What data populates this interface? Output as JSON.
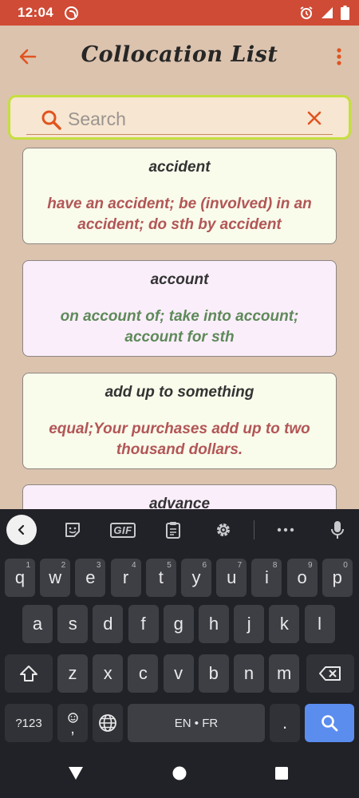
{
  "status_bar": {
    "time": "12:04"
  },
  "app_bar": {
    "title": "Collocation List"
  },
  "search": {
    "placeholder": "Search",
    "value": ""
  },
  "cards": [
    {
      "word": "accident",
      "meaning": "have an accident; be (involved) in an accident; do sth by accident",
      "bg": "#f9fbeb",
      "meaning_color": "#b25656"
    },
    {
      "word": "account",
      "meaning": "on account of; take into account; account for sth",
      "bg": "#fbeefb",
      "meaning_color": "#5e8a59"
    },
    {
      "word": "add up to something",
      "meaning": "equal;Your purchases add up to two thousand dollars.",
      "bg": "#f9fbeb",
      "meaning_color": "#b25656"
    },
    {
      "word": "advance",
      "meaning": "",
      "bg": "#fbeefb",
      "meaning_color": "#5e8a59"
    }
  ],
  "keyboard": {
    "row1": [
      {
        "k": "q",
        "h": "1"
      },
      {
        "k": "w",
        "h": "2"
      },
      {
        "k": "e",
        "h": "3"
      },
      {
        "k": "r",
        "h": "4"
      },
      {
        "k": "t",
        "h": "5"
      },
      {
        "k": "y",
        "h": "6"
      },
      {
        "k": "u",
        "h": "7"
      },
      {
        "k": "i",
        "h": "8"
      },
      {
        "k": "o",
        "h": "9"
      },
      {
        "k": "p",
        "h": "0"
      }
    ],
    "row2": [
      "a",
      "s",
      "d",
      "f",
      "g",
      "h",
      "j",
      "k",
      "l"
    ],
    "row3": [
      "z",
      "x",
      "c",
      "v",
      "b",
      "n",
      "m"
    ],
    "symbols_label": "?123",
    "comma_label": ",",
    "space_label": "EN • FR",
    "period_label": ".",
    "gif_label": "GIF"
  },
  "colors": {
    "accent": "#e0541f",
    "status_bar": "#cf4b36",
    "background": "#dcc3ae",
    "search_border": "#c5de3f",
    "enter_key": "#5b8def"
  }
}
